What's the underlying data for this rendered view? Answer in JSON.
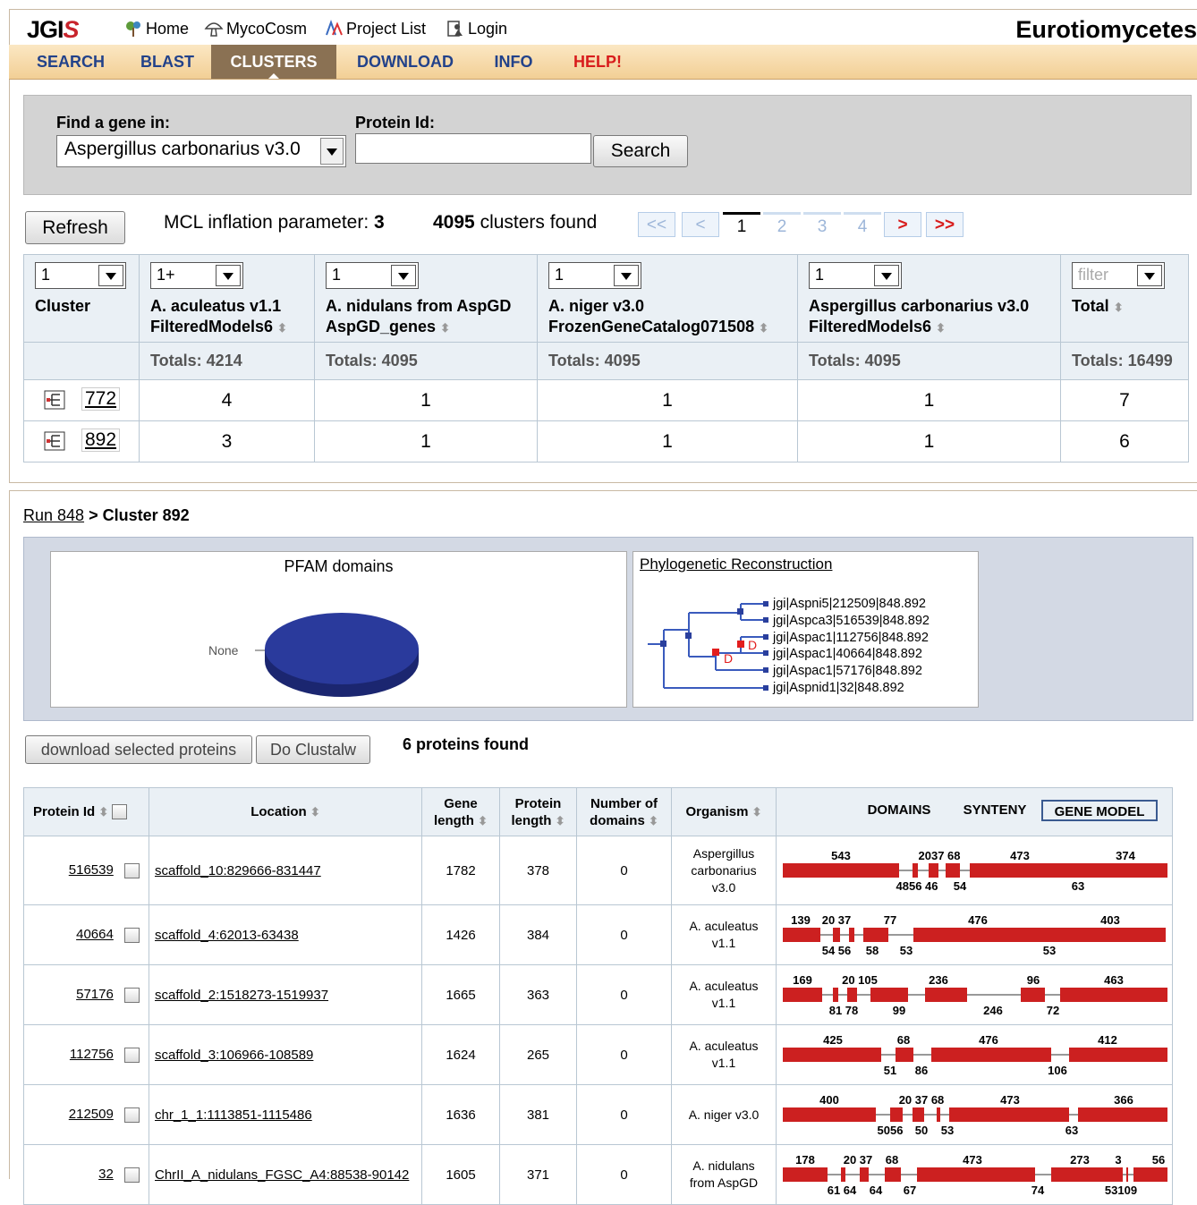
{
  "header": {
    "logo_text": "JGI",
    "logo_accent": "S",
    "links": [
      "Home",
      "MycoCosm",
      "Project List",
      "Login"
    ],
    "site_title": "Eurotiomycetes"
  },
  "nav": {
    "items": [
      "SEARCH",
      "BLAST",
      "CLUSTERS",
      "DOWNLOAD",
      "INFO",
      "HELP!"
    ],
    "active": "CLUSTERS"
  },
  "find": {
    "find_label": "Find a gene in:",
    "genome_value": "Aspergillus carbonarius v3.0",
    "protein_label": "Protein Id:",
    "protein_value": "",
    "search_button": "Search"
  },
  "toolbar": {
    "refresh_button": "Refresh",
    "mcl_label": "MCL inflation parameter:",
    "mcl_value": "3",
    "clusters_count": "4095",
    "clusters_label": "clusters found",
    "pager": [
      "<<",
      "<",
      "1",
      "2",
      "3",
      "4",
      ">",
      ">>"
    ],
    "current_page": "1"
  },
  "cluster_table": {
    "columns": [
      {
        "filter": "1",
        "name1": "Cluster",
        "name2": "",
        "total": ""
      },
      {
        "filter": "1+",
        "name1": "A. aculeatus v1.1",
        "name2": "FilteredModels6",
        "total": "Totals: 4214"
      },
      {
        "filter": "1",
        "name1": "A. nidulans from AspGD",
        "name2": "AspGD_genes",
        "total": "Totals: 4095"
      },
      {
        "filter": "1",
        "name1": "A. niger v3.0",
        "name2": "FrozenGeneCatalog071508",
        "total": "Totals: 4095"
      },
      {
        "filter": "1",
        "name1": "Aspergillus carbonarius v3.0",
        "name2": "FilteredModels6",
        "total": "Totals: 4095"
      },
      {
        "filter": "filter",
        "name1": "Total",
        "name2": "",
        "total": "Totals: 16499"
      }
    ],
    "rows": [
      {
        "cluster": "772",
        "values": [
          "4",
          "1",
          "1",
          "1",
          "7"
        ]
      },
      {
        "cluster": "892",
        "values": [
          "3",
          "1",
          "1",
          "1",
          "6"
        ]
      }
    ]
  },
  "cluster_detail": {
    "run_link": "Run 848",
    "separator": ">",
    "cluster_title": "Cluster 892",
    "pfam_title": "PFAM domains",
    "pfam_label": "None",
    "pfam_color": "#2a3a9c",
    "phylo_title": "Phylogenetic Reconstruction",
    "phylo_leaves": [
      "jgi|Aspni5|212509|848.892",
      "jgi|Aspca3|516539|848.892",
      "jgi|Aspac1|112756|848.892",
      "jgi|Aspac1|40664|848.892",
      "jgi|Aspac1|57176|848.892",
      "jgi|Aspnid1|32|848.892"
    ],
    "dup_marker": "D"
  },
  "protein_section": {
    "download_button": "download selected proteins",
    "clustalw_button": "Do Clustalw",
    "found_text": "6 proteins found",
    "headers": {
      "protein_id": "Protein Id",
      "location": "Location",
      "gene_length_1": "Gene",
      "gene_length_2": "length",
      "protein_length_1": "Protein",
      "protein_length_2": "length",
      "domains_1": "Number of",
      "domains_2": "domains",
      "organism": "Organism"
    },
    "view_tabs": [
      "DOMAINS",
      "SYNTENY",
      "GENE MODEL"
    ],
    "selected_tab": "GENE MODEL",
    "exon_color": "#cc2020",
    "rows": [
      {
        "id": "516539",
        "location": "scaffold_10:829666-831447",
        "gene_length": "1782",
        "protein_length": "378",
        "domains": "0",
        "organism": [
          "Aspergillus",
          "carbonarius",
          "v3.0"
        ],
        "exons": [
          [
            0,
            130
          ],
          [
            145,
            151
          ],
          [
            163,
            174
          ],
          [
            182,
            198
          ],
          [
            209,
            352
          ],
          [
            338,
            430
          ]
        ],
        "top_labels": [
          [
            "543",
            65
          ],
          [
            "2037 68",
            175
          ],
          [
            "473",
            265
          ],
          [
            "374",
            383
          ]
        ],
        "bot_labels": [
          [
            "4856 46",
            150
          ],
          [
            "54",
            198
          ],
          [
            "63",
            330
          ]
        ]
      },
      {
        "id": "40664",
        "location": "scaffold_4:62013-63438",
        "gene_length": "1426",
        "protein_length": "384",
        "domains": "0",
        "organism": [
          "A. aculeatus",
          "v1.1"
        ],
        "exons": [
          [
            0,
            42
          ],
          [
            56,
            64
          ],
          [
            74,
            80
          ],
          [
            90,
            118
          ],
          [
            146,
            305
          ],
          [
            305,
            428
          ]
        ],
        "top_labels": [
          [
            "139",
            20
          ],
          [
            "20 37",
            60
          ],
          [
            "77",
            120
          ],
          [
            "476",
            218
          ],
          [
            "403",
            366
          ]
        ],
        "bot_labels": [
          [
            "54 56",
            60
          ],
          [
            "58",
            100
          ],
          [
            "53",
            138
          ],
          [
            "53",
            298
          ]
        ]
      },
      {
        "id": "57176",
        "location": "scaffold_2:1518273-1519937",
        "gene_length": "1665",
        "protein_length": "363",
        "domains": "0",
        "organism": [
          "A. aculeatus",
          "v1.1"
        ],
        "exons": [
          [
            0,
            44
          ],
          [
            56,
            62
          ],
          [
            72,
            83
          ],
          [
            98,
            140
          ],
          [
            159,
            206
          ],
          [
            266,
            293
          ],
          [
            310,
            430
          ]
        ],
        "top_labels": [
          [
            "169",
            22
          ],
          [
            "20 105",
            86
          ],
          [
            "236",
            174
          ],
          [
            "96",
            280
          ],
          [
            "463",
            370
          ]
        ],
        "bot_labels": [
          [
            "81 78",
            68
          ],
          [
            "99",
            130
          ],
          [
            "246",
            235
          ],
          [
            "72",
            302
          ]
        ]
      },
      {
        "id": "112756",
        "location": "scaffold_3:106966-108589",
        "gene_length": "1624",
        "protein_length": "265",
        "domains": "0",
        "organism": [
          "A. aculeatus",
          "v1.1"
        ],
        "exons": [
          [
            0,
            110
          ],
          [
            126,
            146
          ],
          [
            166,
            300
          ],
          [
            320,
            430
          ]
        ],
        "top_labels": [
          [
            "425",
            56
          ],
          [
            "68",
            135
          ],
          [
            "476",
            230
          ],
          [
            "412",
            363
          ]
        ],
        "bot_labels": [
          [
            "51",
            120
          ],
          [
            "86",
            155
          ],
          [
            "106",
            307
          ]
        ]
      },
      {
        "id": "212509",
        "location": "chr_1_1:1113851-1115486",
        "gene_length": "1636",
        "protein_length": "381",
        "domains": "0",
        "organism": [
          "A. niger v3.0"
        ],
        "exons": [
          [
            0,
            104
          ],
          [
            120,
            134
          ],
          [
            145,
            158
          ],
          [
            172,
            176
          ],
          [
            186,
            320
          ],
          [
            330,
            430
          ]
        ],
        "top_labels": [
          [
            "400",
            52
          ],
          [
            "20 37 68",
            155
          ],
          [
            "473",
            254
          ],
          [
            "366",
            381
          ]
        ],
        "bot_labels": [
          [
            "5056",
            120
          ],
          [
            "50",
            155
          ],
          [
            "53",
            184
          ],
          [
            "63",
            323
          ]
        ]
      },
      {
        "id": "32",
        "location": "ChrII_A_nidulans_FGSC_A4:88538-90142",
        "gene_length": "1605",
        "protein_length": "371",
        "domains": "0",
        "organism": [
          "A. nidulans",
          "from AspGD"
        ],
        "exons": [
          [
            0,
            50
          ],
          [
            65,
            70
          ],
          [
            86,
            96
          ],
          [
            114,
            132
          ],
          [
            150,
            282
          ],
          [
            300,
            380
          ],
          [
            384,
            386
          ],
          [
            392,
            430
          ]
        ],
        "top_labels": [
          [
            "178",
            25
          ],
          [
            "20 37",
            84
          ],
          [
            "68",
            122
          ],
          [
            "473",
            212
          ],
          [
            "273",
            332
          ],
          [
            "3",
            375
          ],
          [
            "56",
            420
          ]
        ],
        "bot_labels": [
          [
            "61 64",
            66
          ],
          [
            "64",
            104
          ],
          [
            "67",
            142
          ],
          [
            "74",
            285
          ],
          [
            "53109",
            378
          ]
        ]
      }
    ]
  }
}
